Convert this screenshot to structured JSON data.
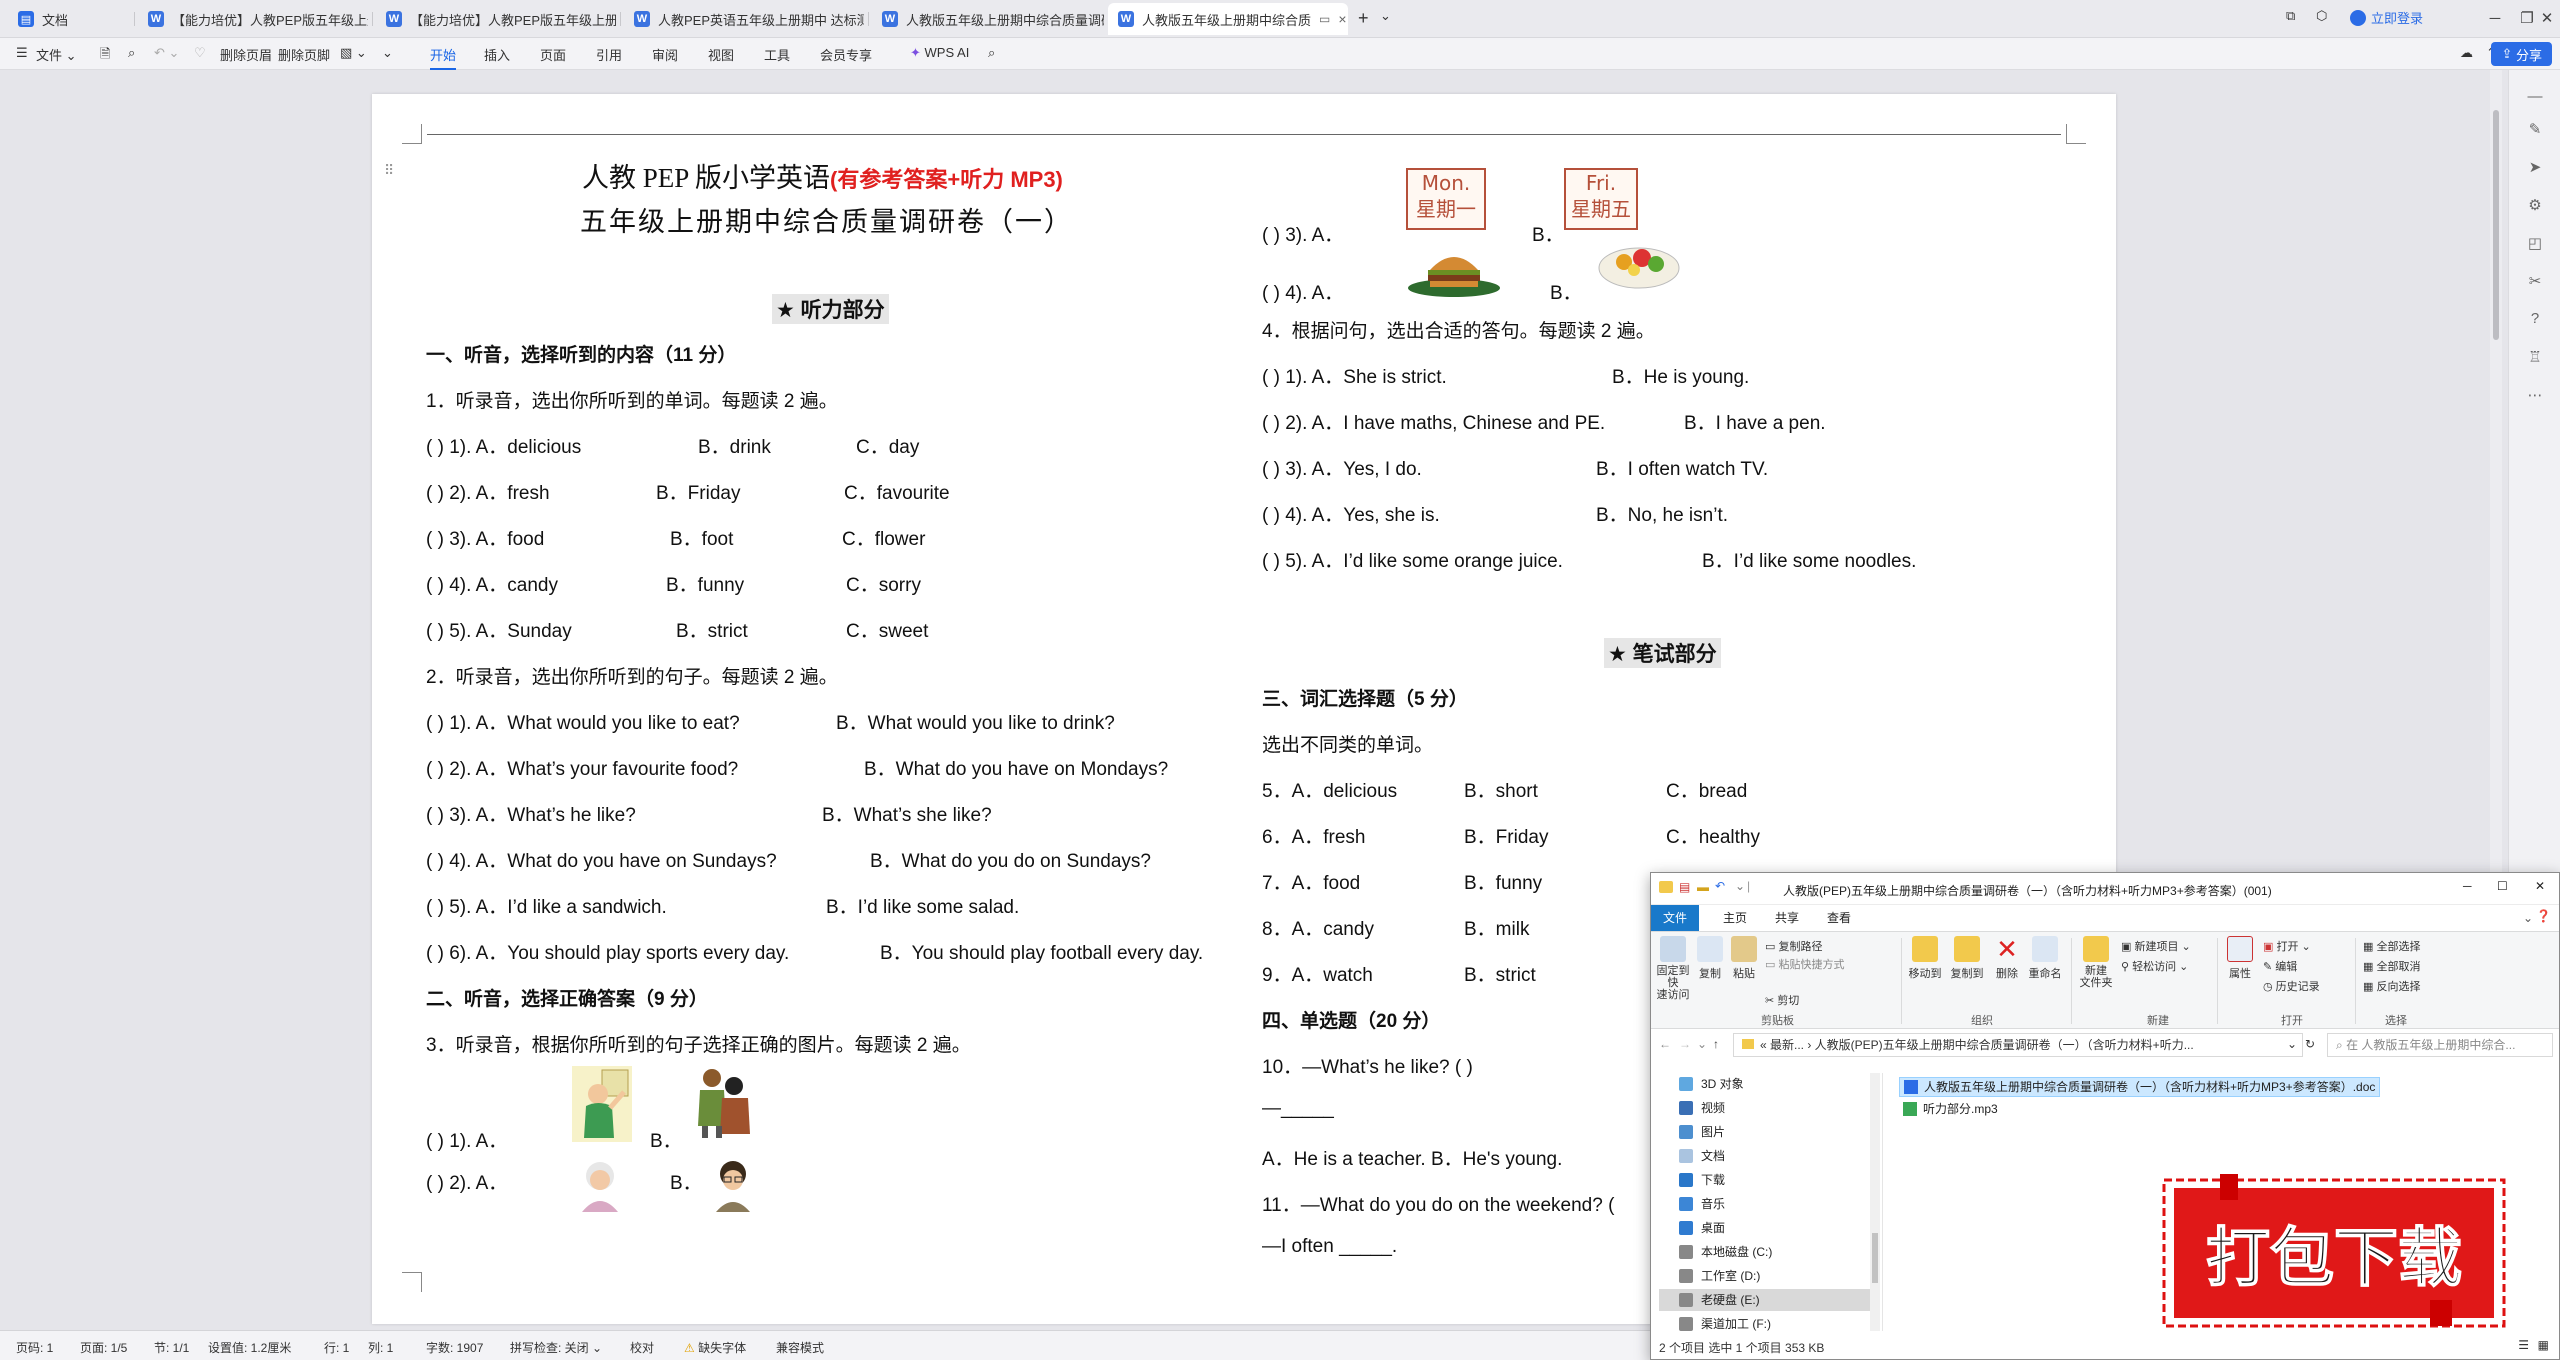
{
  "tabs": [
    {
      "label": "文档",
      "active": false
    },
    {
      "label": "【能力培优】人教PEP版五年级上册英语",
      "active": false
    },
    {
      "label": "【能力培优】人教PEP版五年级上册",
      "active": false
    },
    {
      "label": "人教PEP英语五年级上册期中 达标测",
      "active": false
    },
    {
      "label": "人教版五年级上册期中综合质量调研卷",
      "active": false
    },
    {
      "label": "人教版五年级上册期中综合质",
      "active": true
    }
  ],
  "titlebar": {
    "login": "立即登录"
  },
  "menubar": {
    "file": "文件",
    "delete_header": "删除页眉",
    "delete_footer": "删除页脚",
    "items": [
      "开始",
      "插入",
      "页面",
      "引用",
      "审阅",
      "视图",
      "工具",
      "会员专享"
    ],
    "active_item": "开始",
    "wps_ai": "WPS AI",
    "share": "分享"
  },
  "doc": {
    "title1_main": "人教 PEP 版小学英语",
    "title1_red": "(有参考答案+听力 MP3)",
    "title2": "五年级上册期中综合质量调研卷（一）",
    "listening_heading": "★  听力部分",
    "sec1": "一、听音，选择听到的内容（11 分）",
    "q1_intro": "1．听录音，选出你所听到的单词。每题读 2 遍。",
    "q1_rows": [
      {
        "num": "(        ) 1). A．delicious",
        "b": "B．drink",
        "c": "C．day"
      },
      {
        "num": "(        ) 2). A．fresh",
        "b": "B．Friday",
        "c": "C．favourite"
      },
      {
        "num": "(        ) 3). A．food",
        "b": "B．foot",
        "c": "C．flower"
      },
      {
        "num": "(        ) 4). A．candy",
        "b": "B．funny",
        "c": "C．sorry"
      },
      {
        "num": "(        ) 5). A．Sunday",
        "b": "B．strict",
        "c": "C．sweet"
      }
    ],
    "q2_intro": "2．听录音，选出你所听到的句子。每题读 2 遍。",
    "q2_rows": [
      {
        "a": "(        ) 1). A．What would you like to eat?",
        "b": "B．What would you like to drink?"
      },
      {
        "a": "(        ) 2). A．What’s your favourite food?",
        "b": "B．What do you have on Mondays?"
      },
      {
        "a": "(        ) 3). A．What’s he like?",
        "b": "B．What’s she like?"
      },
      {
        "a": "(        ) 4). A．What do you have on Sundays?",
        "b": "B．What do you do on Sundays?"
      },
      {
        "a": "(        ) 5). A．I’d like a sandwich.",
        "b": "B．I’d like some salad."
      },
      {
        "a": "(        ) 6). A．You should play sports every day.",
        "b": "B．You should play football every day."
      }
    ],
    "sec2": "二、听音，选择正确答案（9 分）",
    "q3_intro": "3．听录音，根据你所听到的句子选择正确的图片。每题读 2 遍。",
    "q3_rows": [
      {
        "a": "(        ) 1). A．",
        "b": "B．"
      },
      {
        "a": "(        ) 2). A．",
        "b": "B．"
      }
    ],
    "q3_right": [
      {
        "a": "(        ) 3).   A．",
        "b": "B．",
        "day_a_en": "Mon.",
        "day_a_cn": "星期一",
        "day_b_en": "Fri.",
        "day_b_cn": "星期五"
      },
      {
        "a": "(        ) 4).   A．",
        "b": "B．"
      }
    ],
    "q4_intro": "4．根据问句，选出合适的答句。每题读 2 遍。",
    "q4_rows": [
      {
        "a": "(        ) 1). A．She is strict.",
        "b": "B．He is young."
      },
      {
        "a": "(        ) 2). A．I have maths, Chinese and PE.",
        "b": "B．I have a pen."
      },
      {
        "a": "(        ) 3). A．Yes, I do.",
        "b": "B．I often watch TV."
      },
      {
        "a": "(        ) 4). A．Yes, she is.",
        "b": "B．No, he isn’t."
      },
      {
        "a": "(        ) 5). A．I’d like some orange juice.",
        "b": "B．I’d like some noodles."
      }
    ],
    "writing_heading": "★  笔试部分",
    "sec3": "三、词汇选择题（5 分）",
    "sec3_intro": "选出不同类的单词。",
    "vocab_rows": [
      {
        "a": "5．A．delicious",
        "b": "B．short",
        "c": "C．bread"
      },
      {
        "a": "6．A．fresh",
        "b": "B．Friday",
        "c": "C．healthy"
      },
      {
        "a": "7．A．food",
        "b": "B．funny",
        "c": ""
      },
      {
        "a": "8．A．candy",
        "b": "B．milk",
        "c": ""
      },
      {
        "a": "9．A．watch",
        "b": "B．strict",
        "c": ""
      }
    ],
    "sec4": "四、单选题（20 分）",
    "q10": "10．—What’s he like? (    )",
    "q10_blank": "—_____",
    "q10_opts": "A．He is a teacher.      B．He's young.",
    "q11": "11．—What do you do on the weekend? (",
    "q11_blank": "—I often _____."
  },
  "statusbar": {
    "page": "页码: 1",
    "pages": "页面: 1/5",
    "section": "节: 1/1",
    "setting": "设置值: 1.2厘米",
    "line": "行: 1",
    "col": "列: 1",
    "words": "字数: 1907",
    "spell": "拼写检查: 关闭",
    "proof": "校对",
    "missing_font": "缺失字体",
    "compat": "兼容模式"
  },
  "explorer": {
    "title": "人教版(PEP)五年级上册期中综合质量调研卷（一）（含听力材料+听力MP3+参考答案）(001)",
    "tabs": [
      "文件",
      "主页",
      "共享",
      "查看"
    ],
    "ribbon": {
      "pin": "固定到快\n速访问",
      "copy": "复制",
      "paste": "粘贴",
      "copy_path": "复制路径",
      "paste_shortcut": "粘贴快捷方式",
      "cut": "剪切",
      "move_to": "移动到",
      "copy_to": "复制到",
      "delete": "删除",
      "rename": "重命名",
      "new_folder": "新建\n文件夹",
      "new_item": "新建项目",
      "easy_access": "轻松访问",
      "properties": "属性",
      "open": "打开",
      "edit": "编辑",
      "history": "历史记录",
      "select_all": "全部选择",
      "select_none": "全部取消",
      "invert": "反向选择",
      "groups": [
        "剪贴板",
        "组织",
        "新建",
        "打开",
        "选择"
      ]
    },
    "address": "«  最新...  ›  人教版(PEP)五年级上册期中综合质量调研卷（一）（含听力材料+听力...",
    "search_placeholder": "在 人教版五年级上册期中综合...",
    "nav": [
      "3D 对象",
      "视频",
      "图片",
      "文档",
      "下载",
      "音乐",
      "桌面",
      "本地磁盘 (C:)",
      "工作室 (D:)",
      "老硬盘 (E:)",
      "渠道加工 (F:)"
    ],
    "nav_selected": "老硬盘 (E:)",
    "files": [
      {
        "name": "人教版五年级上册期中综合质量调研卷（一）（含听力材料+听力MP3+参考答案）.doc",
        "selected": true
      },
      {
        "name": "听力部分.mp3",
        "selected": false
      }
    ],
    "status": "2 个项目    选中 1 个项目  353 KB"
  },
  "badge": {
    "text": "打包下载"
  }
}
